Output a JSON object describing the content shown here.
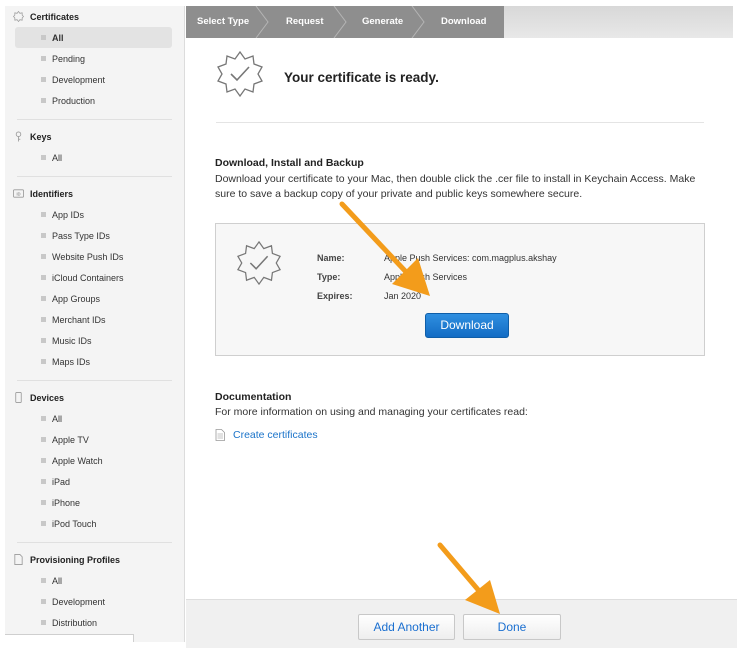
{
  "sidebar": {
    "sections": [
      {
        "title": "Certificates",
        "icon": "certificate-icon",
        "items": [
          "All",
          "Pending",
          "Development",
          "Production"
        ],
        "active": "All"
      },
      {
        "title": "Keys",
        "icon": "key-icon",
        "items": [
          "All"
        ]
      },
      {
        "title": "Identifiers",
        "icon": "id-icon",
        "items": [
          "App IDs",
          "Pass Type IDs",
          "Website Push IDs",
          "iCloud Containers",
          "App Groups",
          "Merchant IDs",
          "Music IDs",
          "Maps IDs"
        ]
      },
      {
        "title": "Devices",
        "icon": "device-icon",
        "items": [
          "All",
          "Apple TV",
          "Apple Watch",
          "iPad",
          "iPhone",
          "iPod Touch"
        ]
      },
      {
        "title": "Provisioning Profiles",
        "icon": "document-icon",
        "items": [
          "All",
          "Development",
          "Distribution"
        ]
      }
    ]
  },
  "steps": [
    "Select Type",
    "Request",
    "Generate",
    "Download"
  ],
  "header": {
    "title": "Your certificate is ready."
  },
  "download_section": {
    "heading": "Download, Install and Backup",
    "text": "Download your certificate to your Mac, then double click the .cer file to install in Keychain Access. Make sure to save a backup copy of your private and public keys somewhere secure."
  },
  "certificate": {
    "name_label": "Name:",
    "name_value": "Apple Push Services: com.magplus.akshay",
    "type_label": "Type:",
    "type_value": "Apple Push Services",
    "expires_label": "Expires:",
    "expires_value": "Jan 2020",
    "download_label": "Download"
  },
  "documentation": {
    "heading": "Documentation",
    "text": "For more information on using and managing your certificates read:",
    "link": "Create certificates"
  },
  "footer": {
    "add_another": "Add Another",
    "done": "Done"
  },
  "colors": {
    "accent": "#1a73c9",
    "button": "#136cc4",
    "arrow": "#f39c1b",
    "step_dark": "#8e8e8e"
  }
}
